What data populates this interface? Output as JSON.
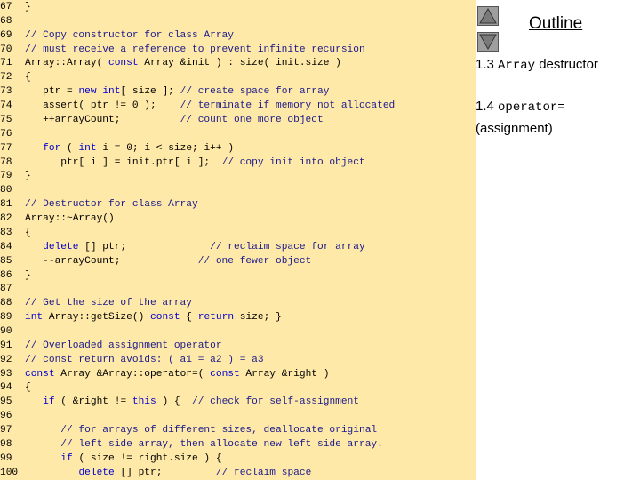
{
  "code_lines": [
    {
      "n": "67",
      "parts": [
        {
          "t": "}",
          "c": "tx"
        }
      ]
    },
    {
      "n": "68",
      "parts": []
    },
    {
      "n": "69",
      "parts": [
        {
          "t": "// Copy constructor for class Array",
          "c": "cm"
        }
      ]
    },
    {
      "n": "70",
      "parts": [
        {
          "t": "// must receive a reference to prevent infinite recursion",
          "c": "cm"
        }
      ]
    },
    {
      "n": "71",
      "parts": [
        {
          "t": "Array::Array( ",
          "c": "tx"
        },
        {
          "t": "const",
          "c": "kw"
        },
        {
          "t": " Array &init ) : size( init.size )",
          "c": "tx"
        }
      ]
    },
    {
      "n": "72",
      "parts": [
        {
          "t": "{",
          "c": "tx"
        }
      ]
    },
    {
      "n": "73",
      "parts": [
        {
          "t": "   ptr = ",
          "c": "tx"
        },
        {
          "t": "new",
          "c": "kw"
        },
        {
          "t": " ",
          "c": "tx"
        },
        {
          "t": "int",
          "c": "kw"
        },
        {
          "t": "[ size ]; ",
          "c": "tx"
        },
        {
          "t": "// create space for array",
          "c": "cm"
        }
      ]
    },
    {
      "n": "74",
      "parts": [
        {
          "t": "   assert( ptr != 0 );    ",
          "c": "tx"
        },
        {
          "t": "// terminate if memory not allocated",
          "c": "cm"
        }
      ]
    },
    {
      "n": "75",
      "parts": [
        {
          "t": "   ++arrayCount;          ",
          "c": "tx"
        },
        {
          "t": "// count one more object",
          "c": "cm"
        }
      ]
    },
    {
      "n": "76",
      "parts": []
    },
    {
      "n": "77",
      "parts": [
        {
          "t": "   ",
          "c": "tx"
        },
        {
          "t": "for",
          "c": "kw"
        },
        {
          "t": " ( ",
          "c": "tx"
        },
        {
          "t": "int",
          "c": "kw"
        },
        {
          "t": " i = 0; i < size; i++ )",
          "c": "tx"
        }
      ]
    },
    {
      "n": "78",
      "parts": [
        {
          "t": "      ptr[ i ] = init.ptr[ i ];  ",
          "c": "tx"
        },
        {
          "t": "// copy init into object",
          "c": "cm"
        }
      ]
    },
    {
      "n": "79",
      "parts": [
        {
          "t": "}",
          "c": "tx"
        }
      ]
    },
    {
      "n": "80",
      "parts": []
    },
    {
      "n": "81",
      "parts": [
        {
          "t": "// Destructor for class Array",
          "c": "cm"
        }
      ]
    },
    {
      "n": "82",
      "parts": [
        {
          "t": "Array::~Array()",
          "c": "tx"
        }
      ]
    },
    {
      "n": "83",
      "parts": [
        {
          "t": "{",
          "c": "tx"
        }
      ]
    },
    {
      "n": "84",
      "parts": [
        {
          "t": "   ",
          "c": "tx"
        },
        {
          "t": "delete",
          "c": "kw"
        },
        {
          "t": " [] ptr;              ",
          "c": "tx"
        },
        {
          "t": "// reclaim space for array",
          "c": "cm"
        }
      ]
    },
    {
      "n": "85",
      "parts": [
        {
          "t": "   --arrayCount;             ",
          "c": "tx"
        },
        {
          "t": "// one fewer object",
          "c": "cm"
        }
      ]
    },
    {
      "n": "86",
      "parts": [
        {
          "t": "}",
          "c": "tx"
        }
      ]
    },
    {
      "n": "87",
      "parts": []
    },
    {
      "n": "88",
      "parts": [
        {
          "t": "// Get the size of the array",
          "c": "cm"
        }
      ]
    },
    {
      "n": "89",
      "parts": [
        {
          "t": "int",
          "c": "kw"
        },
        {
          "t": " Array::getSize() ",
          "c": "tx"
        },
        {
          "t": "const",
          "c": "kw"
        },
        {
          "t": " { ",
          "c": "tx"
        },
        {
          "t": "return",
          "c": "kw"
        },
        {
          "t": " size; }",
          "c": "tx"
        }
      ]
    },
    {
      "n": "90",
      "parts": []
    },
    {
      "n": "91",
      "parts": [
        {
          "t": "// Overloaded assignment operator",
          "c": "cm"
        }
      ]
    },
    {
      "n": "92",
      "parts": [
        {
          "t": "// const return avoids: ( a1 = a2 ) = a3",
          "c": "cm"
        }
      ]
    },
    {
      "n": "93",
      "parts": [
        {
          "t": "const",
          "c": "kw"
        },
        {
          "t": " Array &Array::operator=( ",
          "c": "tx"
        },
        {
          "t": "const",
          "c": "kw"
        },
        {
          "t": " Array &right )",
          "c": "tx"
        }
      ]
    },
    {
      "n": "94",
      "parts": [
        {
          "t": "{",
          "c": "tx"
        }
      ]
    },
    {
      "n": "95",
      "parts": [
        {
          "t": "   ",
          "c": "tx"
        },
        {
          "t": "if",
          "c": "kw"
        },
        {
          "t": " ( &right != ",
          "c": "tx"
        },
        {
          "t": "this",
          "c": "kw"
        },
        {
          "t": " ) {  ",
          "c": "tx"
        },
        {
          "t": "// check for self-assignment",
          "c": "cm"
        }
      ]
    },
    {
      "n": "96",
      "parts": []
    },
    {
      "n": "97",
      "parts": [
        {
          "t": "      ",
          "c": "tx"
        },
        {
          "t": "// for arrays of different sizes, deallocate original",
          "c": "cm"
        }
      ]
    },
    {
      "n": "98",
      "parts": [
        {
          "t": "      ",
          "c": "tx"
        },
        {
          "t": "// left side array, then allocate new left side array.",
          "c": "cm"
        }
      ]
    },
    {
      "n": "99",
      "parts": [
        {
          "t": "      ",
          "c": "tx"
        },
        {
          "t": "if",
          "c": "kw"
        },
        {
          "t": " ( size != right.size ) {",
          "c": "tx"
        }
      ]
    },
    {
      "n": "100",
      "parts": [
        {
          "t": "         ",
          "c": "tx"
        },
        {
          "t": "delete",
          "c": "kw"
        },
        {
          "t": " [] ptr;         ",
          "c": "tx"
        },
        {
          "t": "// reclaim space",
          "c": "cm"
        }
      ]
    }
  ],
  "outline": {
    "title": "Outline",
    "up_icon": "triangle-up-icon",
    "down_icon": "triangle-down-icon",
    "items": [
      {
        "number": "1.3",
        "code": "Array",
        "text": "destructor"
      },
      {
        "number": "1.4",
        "code": "operator=",
        "text": "(assignment)"
      }
    ]
  },
  "colors": {
    "code_bg": "#ffe9a8",
    "keyword": "#0000cc",
    "comment": "#1a1a8c",
    "button": "#9e9e9e"
  }
}
